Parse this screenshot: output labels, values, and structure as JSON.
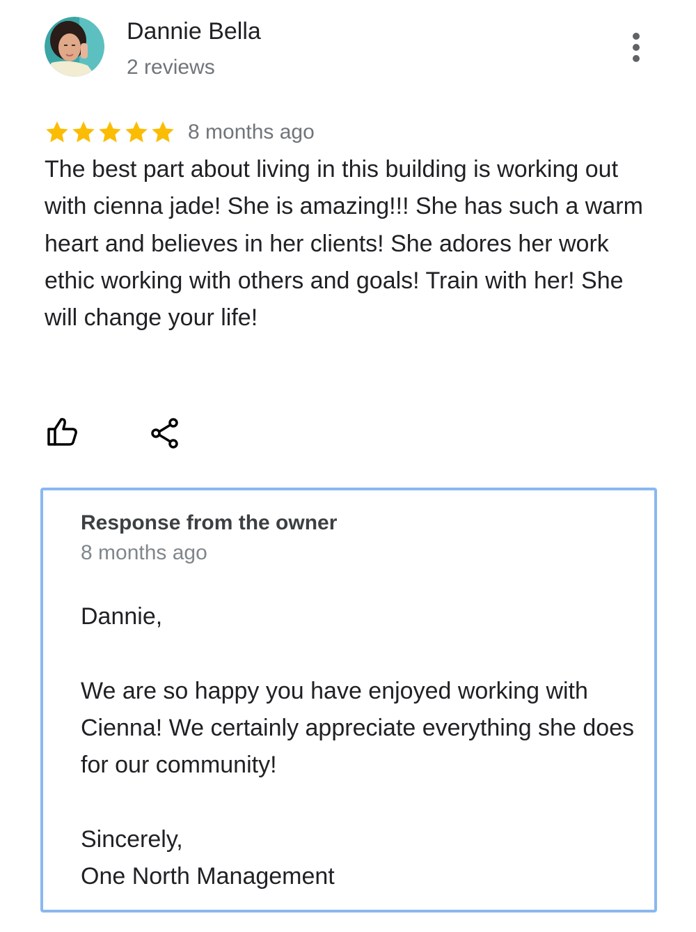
{
  "reviewer": {
    "name": "Dannie Bella",
    "review_count": "2 reviews",
    "avatar_icon": "user-photo-avatar"
  },
  "menu": {
    "icon": "more-vertical-icon"
  },
  "review": {
    "rating": 5,
    "rating_max": 5,
    "star_color": "#fbbc04",
    "time": "8 months ago",
    "text": "The best part about living in this building is working out with cienna jade! She is amazing!!! She has such a warm heart and believes in her clients! She adores her work ethic working with others and goals! Train with her! She will change your life!"
  },
  "actions": {
    "like_icon": "thumbs-up-icon",
    "share_icon": "share-icon"
  },
  "owner_response": {
    "title": "Response from the owner",
    "time": "8 months ago",
    "greeting": "Dannie,",
    "message": "We are so happy you have enjoyed working with Cienna! We certainly appreciate everything she does for our community!",
    "closing": "Sincerely,",
    "signature": "One North Management",
    "border_color": "#8ab8ef"
  }
}
